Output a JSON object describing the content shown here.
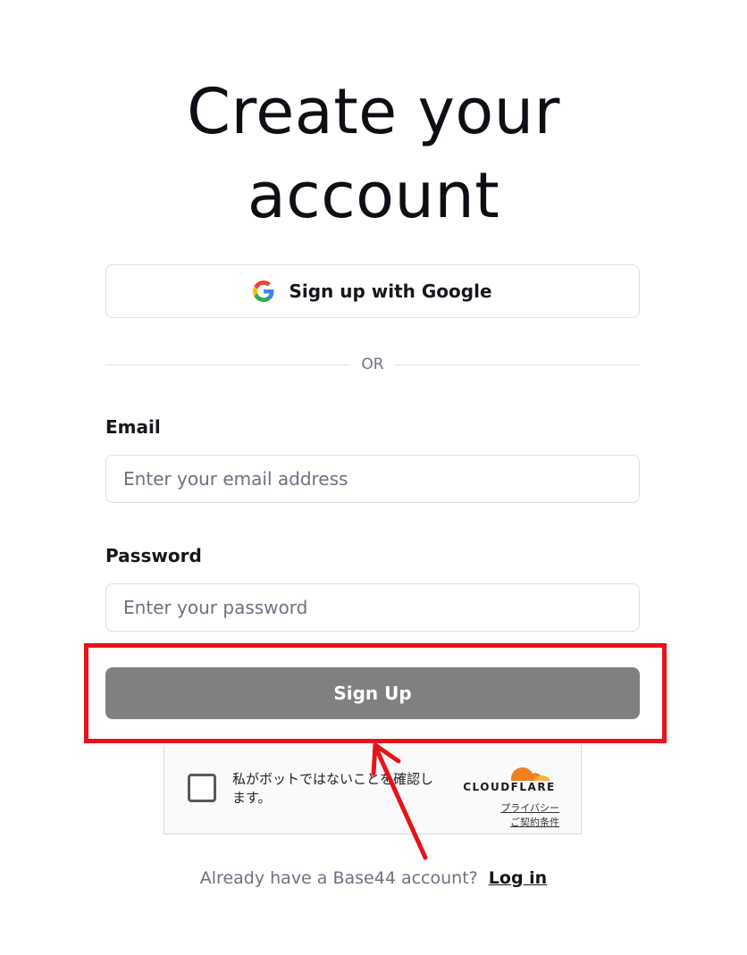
{
  "page": {
    "title_line1": "Create your",
    "title_line2": "account"
  },
  "google_button": {
    "label": "Sign up with Google",
    "icon": "google-icon"
  },
  "divider": {
    "text": "OR"
  },
  "email": {
    "label": "Email",
    "placeholder": "Enter your email address",
    "value": ""
  },
  "password": {
    "label": "Password",
    "placeholder": "Enter your password",
    "value": ""
  },
  "signup_button": {
    "label": "Sign Up",
    "color": "#808080"
  },
  "captcha": {
    "text": "私がボットではないことを確認します。",
    "brand": "CLOUDFLARE",
    "privacy_link": "プライバシー",
    "terms_link": "ご契約条件",
    "brand_color": "#f38020"
  },
  "footer": {
    "prompt": "Already have a Base44 account?",
    "login_link": "Log in"
  },
  "annotation": {
    "highlight_color": "#e8121b"
  }
}
